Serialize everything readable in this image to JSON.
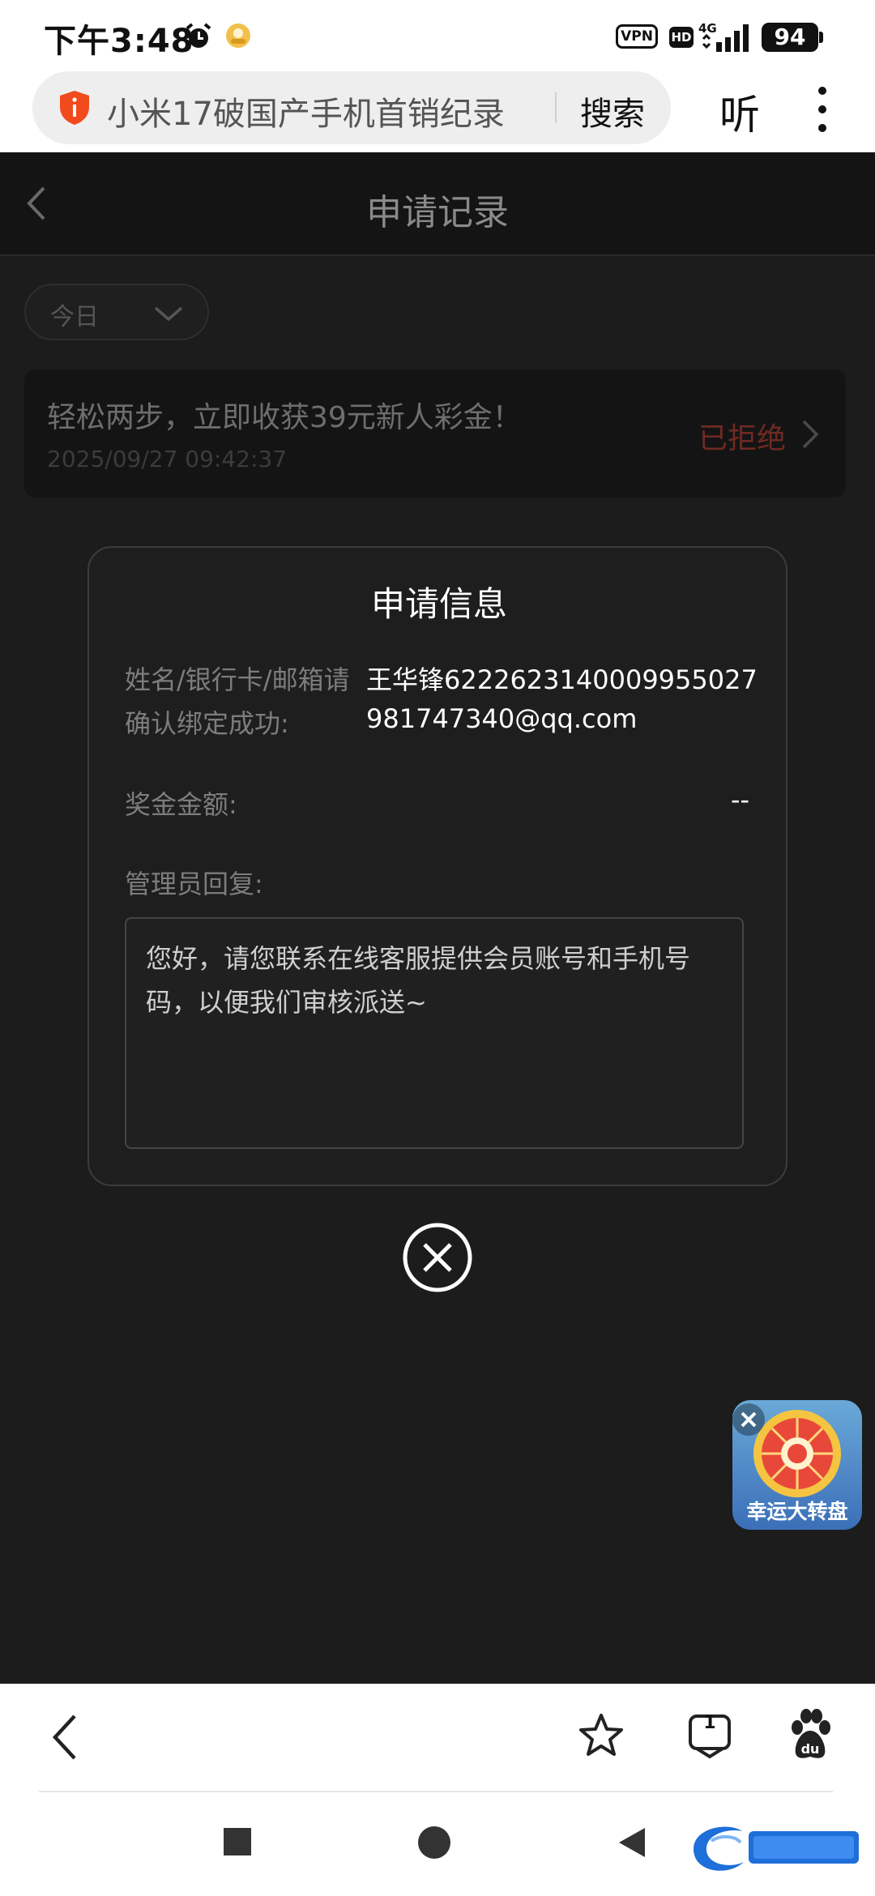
{
  "status_bar": {
    "time": "下午3:48",
    "vpn": "VPN",
    "hd": "HD",
    "network": "4G",
    "battery": "94"
  },
  "browser": {
    "url_text": "小米17破国产手机首销纪录",
    "search_label": "搜索",
    "listen_label": "听"
  },
  "page": {
    "title": "申请记录",
    "filter_label": "今日"
  },
  "record": {
    "title": "轻松两步，立即收获39元新人彩金！",
    "time": "2025/09/27 09:42:37",
    "status": "已拒绝"
  },
  "modal": {
    "title": "申请信息",
    "name_label_line1": "姓名/银行卡/邮箱请",
    "name_label_line2": "确认绑定成功:",
    "name_value_line1": "王华锋6222623140009955027",
    "name_value_line2": "981747340@qq.com",
    "amount_label": "奖金金额:",
    "amount_value": "--",
    "reply_label": "管理员回复:",
    "reply_text": "您好，请您联系在线客服提供会员账号和手机号码，以便我们审核派送~"
  },
  "float_ad": {
    "label": "幸运大转盘"
  },
  "toolbar": {
    "tab_count": "1"
  },
  "colors": {
    "rejected": "#6f2a22",
    "accent_shield": "#f04a1d"
  }
}
